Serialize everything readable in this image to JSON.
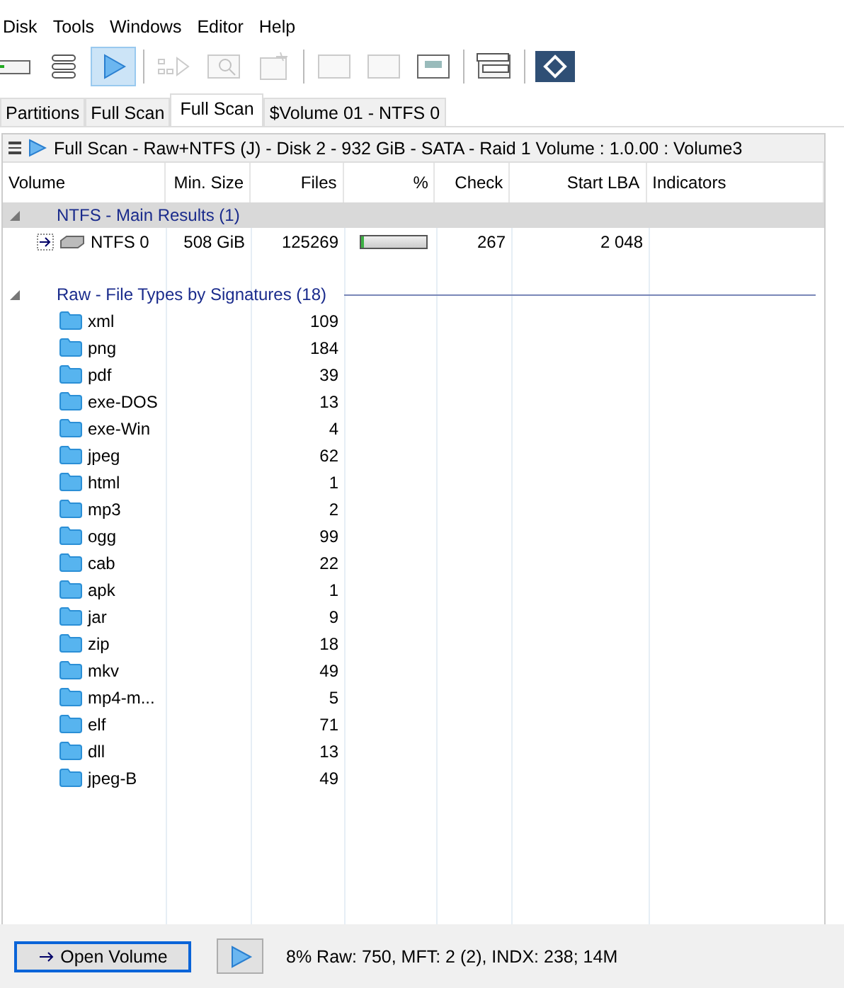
{
  "menu": [
    "Disk",
    "Tools",
    "Windows",
    "Editor",
    "Help"
  ],
  "toolbar": [
    {
      "selected": false,
      "disabled": false
    },
    {
      "selected": false,
      "disabled": false
    },
    {
      "selected": true,
      "disabled": false
    },
    {
      "selected": false,
      "disabled": true
    },
    {
      "selected": false,
      "disabled": true
    },
    {
      "selected": false,
      "disabled": true
    },
    {
      "selected": false,
      "disabled": true
    },
    {
      "selected": false,
      "disabled": true
    },
    {
      "selected": false,
      "disabled": false
    },
    {
      "selected": false,
      "disabled": false
    },
    {
      "selected": false,
      "disabled": false
    }
  ],
  "tabs": [
    {
      "label": "Partitions",
      "selected": false
    },
    {
      "label": "Full Scan",
      "selected": false
    },
    {
      "label": "Full Scan",
      "selected": true
    },
    {
      "label": "$Volume 01 - NTFS 0",
      "selected": false
    }
  ],
  "scan_title": "Full Scan - Raw+NTFS (J) - Disk 2 - 932 GiB - SATA - Raid 1 Volume : 1.0.00 : Volume3",
  "table": {
    "columns": [
      "Volume",
      "Min. Size",
      "Files",
      "%",
      "Check",
      "Start LBA",
      "Indicators"
    ],
    "groups": [
      {
        "title": "NTFS - Main Results (1)",
        "expanded": true,
        "highlighted": true,
        "rows": [
          {
            "kind": "volume",
            "name": "NTFS 0",
            "size": "508 GiB",
            "files": "125269",
            "level": 0.04,
            "check": "267",
            "start_lba": "2 048"
          }
        ]
      },
      {
        "title": "Raw - File Types by Signatures (18)",
        "expanded": true,
        "highlighted": false,
        "rows": [
          {
            "kind": "folder",
            "name": "xml",
            "files": "109"
          },
          {
            "kind": "folder",
            "name": "png",
            "files": "184"
          },
          {
            "kind": "folder",
            "name": "pdf",
            "files": "39"
          },
          {
            "kind": "folder",
            "name": "exe-DOS",
            "files": "13"
          },
          {
            "kind": "folder",
            "name": "exe-Win",
            "files": "4"
          },
          {
            "kind": "folder",
            "name": "jpeg",
            "files": "62"
          },
          {
            "kind": "folder",
            "name": "html",
            "files": "1"
          },
          {
            "kind": "folder",
            "name": "mp3",
            "files": "2"
          },
          {
            "kind": "folder",
            "name": "ogg",
            "files": "99"
          },
          {
            "kind": "folder",
            "name": "cab",
            "files": "22"
          },
          {
            "kind": "folder",
            "name": "apk",
            "files": "1"
          },
          {
            "kind": "folder",
            "name": "jar",
            "files": "9"
          },
          {
            "kind": "folder",
            "name": "zip",
            "files": "18"
          },
          {
            "kind": "folder",
            "name": "mkv",
            "files": "49"
          },
          {
            "kind": "folder",
            "name": "mp4-m...",
            "files": "5"
          },
          {
            "kind": "folder",
            "name": "elf",
            "files": "71"
          },
          {
            "kind": "folder",
            "name": "dll",
            "files": "13"
          },
          {
            "kind": "folder",
            "name": "jpeg-B",
            "files": "49"
          }
        ]
      }
    ]
  },
  "open_button": "Open Volume",
  "status": "8% Raw: 750, MFT: 2 (2), INDX: 238; 14M"
}
